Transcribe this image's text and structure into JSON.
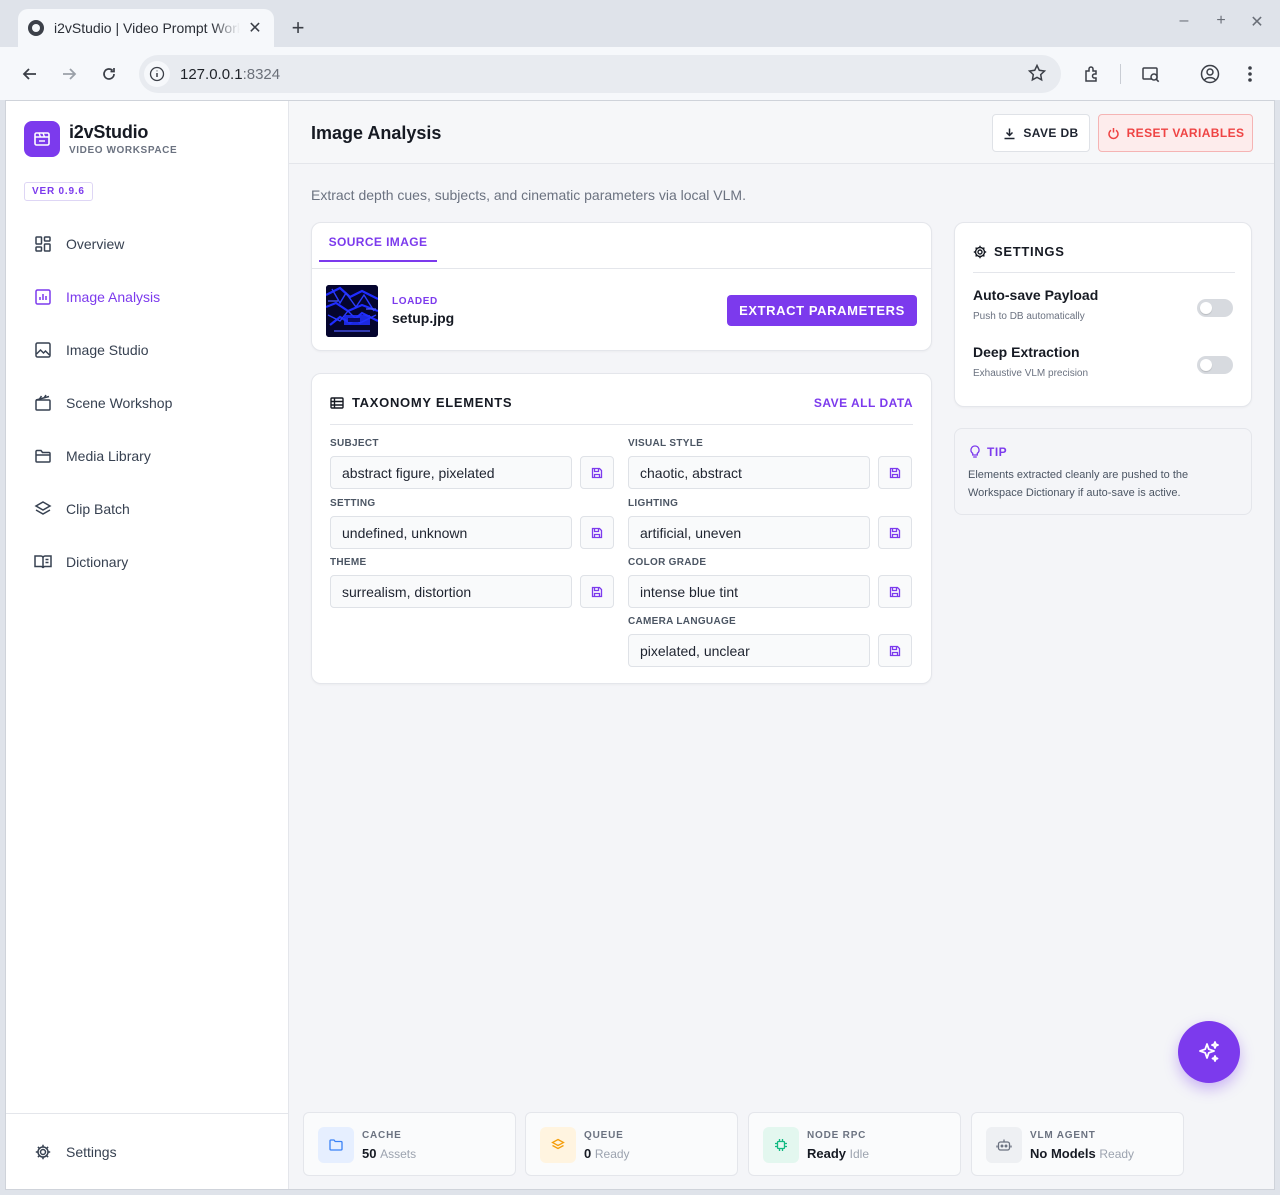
{
  "browser": {
    "tab_title": "i2vStudio | Video Prompt Workspace",
    "url_host": "127.0.0.1",
    "url_port": ":8324"
  },
  "brand": {
    "name": "i2vStudio",
    "subtitle": "VIDEO WORKSPACE",
    "version": "VER 0.9.6"
  },
  "sidebar": {
    "items": [
      {
        "label": "Overview",
        "icon": "grid-icon"
      },
      {
        "label": "Image Analysis",
        "icon": "chart-icon",
        "active": true
      },
      {
        "label": "Image Studio",
        "icon": "image-icon"
      },
      {
        "label": "Scene Workshop",
        "icon": "clapper-icon"
      },
      {
        "label": "Media Library",
        "icon": "folder-icon"
      },
      {
        "label": "Clip Batch",
        "icon": "layers-icon"
      },
      {
        "label": "Dictionary",
        "icon": "book-icon"
      }
    ],
    "settings_label": "Settings"
  },
  "header": {
    "title": "Image Analysis",
    "save_db": "SAVE DB",
    "reset": "RESET VARIABLES"
  },
  "subtitle": "Extract depth cues, subjects, and cinematic parameters via local VLM.",
  "source": {
    "tab": "SOURCE IMAGE",
    "status": "LOADED",
    "filename": "setup.jpg",
    "extract": "EXTRACT PARAMETERS"
  },
  "taxonomy": {
    "title": "TAXONOMY ELEMENTS",
    "save_all": "SAVE ALL DATA",
    "fields": {
      "subject": {
        "label": "SUBJECT",
        "value": "abstract figure, pixelated"
      },
      "setting": {
        "label": "SETTING",
        "value": "undefined, unknown"
      },
      "theme": {
        "label": "THEME",
        "value": "surrealism, distortion"
      },
      "visual_style": {
        "label": "VISUAL STYLE",
        "value": "chaotic, abstract"
      },
      "lighting": {
        "label": "LIGHTING",
        "value": "artificial, uneven"
      },
      "color_grade": {
        "label": "COLOR GRADE",
        "value": "intense blue tint"
      },
      "camera_language": {
        "label": "CAMERA LANGUAGE",
        "value": "pixelated, unclear"
      }
    }
  },
  "settings": {
    "title": "SETTINGS",
    "autosave": {
      "name": "Auto-save Payload",
      "desc": "Push to DB automatically",
      "on": false
    },
    "deep": {
      "name": "Deep Extraction",
      "desc": "Exhaustive VLM precision",
      "on": false
    }
  },
  "tip": {
    "title": "TIP",
    "text": "Elements extracted cleanly are pushed to the Workspace Dictionary if auto-save is active."
  },
  "status": [
    {
      "label": "CACHE",
      "value": "50",
      "sub": "Assets",
      "icon": "folder-icon",
      "color": "#3b82f6"
    },
    {
      "label": "QUEUE",
      "value": "0",
      "sub": "Ready",
      "icon": "stack-icon",
      "color": "#f59e0b"
    },
    {
      "label": "NODE RPC",
      "value": "Ready",
      "sub": "Idle",
      "icon": "chip-icon",
      "color": "#10b981"
    },
    {
      "label": "VLM AGENT",
      "value": "No Models",
      "sub": "Ready",
      "icon": "robot-icon",
      "color": "#6b7280"
    }
  ],
  "colors": {
    "accent": "#7c3aed",
    "danger": "#ef4444"
  }
}
